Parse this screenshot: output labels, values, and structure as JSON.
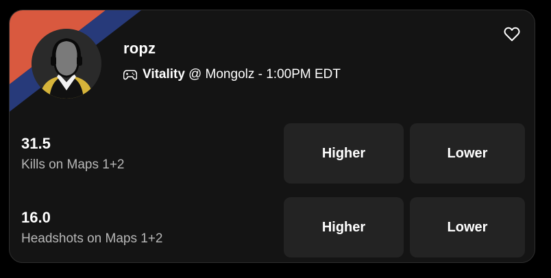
{
  "player": {
    "name": "ropz",
    "avatar_icon": "player-silhouette-avatar",
    "team_colors": [
      "#d9593f",
      "#273a7a"
    ]
  },
  "match": {
    "icon": "controller-icon",
    "team": "Vitality",
    "details": "@ Mongolz - 1:00PM EDT"
  },
  "favorite": {
    "icon": "heart-icon"
  },
  "props": [
    {
      "line": "31.5",
      "stat": "Kills on Maps 1+2",
      "higher_label": "Higher",
      "lower_label": "Lower"
    },
    {
      "line": "16.0",
      "stat": "Headshots on Maps 1+2",
      "higher_label": "Higher",
      "lower_label": "Lower"
    }
  ]
}
